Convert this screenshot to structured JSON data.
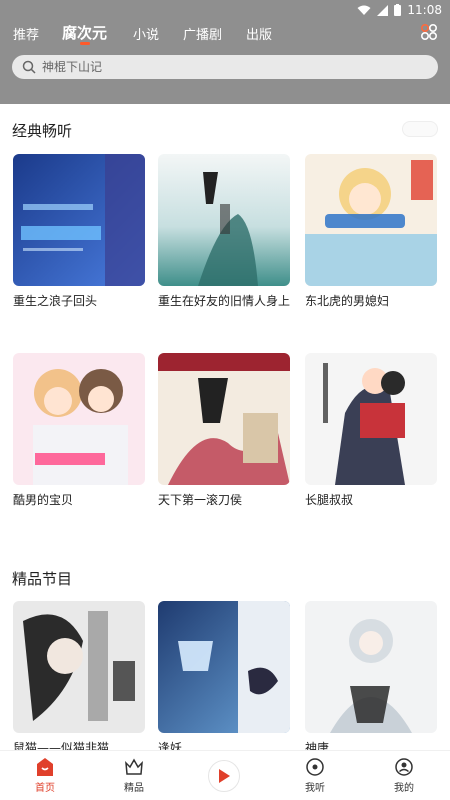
{
  "status_bar": {
    "time": "11:08"
  },
  "tabs": [
    {
      "label": "推荐"
    },
    {
      "label": "腐次元"
    },
    {
      "label": "小说"
    },
    {
      "label": "广播剧"
    },
    {
      "label": "出版"
    }
  ],
  "search": {
    "placeholder": "神棍下山记"
  },
  "sections": [
    {
      "title": "经典畅听",
      "books": [
        {
          "title": "重生之浪子回头"
        },
        {
          "title": "重生在好友的旧情人身上"
        },
        {
          "title": "东北虎的男媳妇"
        },
        {
          "title": "酷男的宝贝"
        },
        {
          "title": "天下第一滚刀侯"
        },
        {
          "title": "长腿叔叔"
        }
      ]
    },
    {
      "title": "精品节目",
      "books": [
        {
          "title": "鼠猫——似猫非猫"
        },
        {
          "title": "逢妖"
        },
        {
          "title": "神唐"
        }
      ]
    }
  ],
  "bottom_nav": [
    {
      "label": "首页",
      "icon": "home-icon"
    },
    {
      "label": "精品",
      "icon": "crown-icon"
    },
    {
      "label": "",
      "icon": "play-icon"
    },
    {
      "label": "我听",
      "icon": "disc-icon"
    },
    {
      "label": "我的",
      "icon": "profile-icon"
    }
  ],
  "colors": {
    "accent": "#e0402b",
    "header": "#8f8f8f"
  }
}
